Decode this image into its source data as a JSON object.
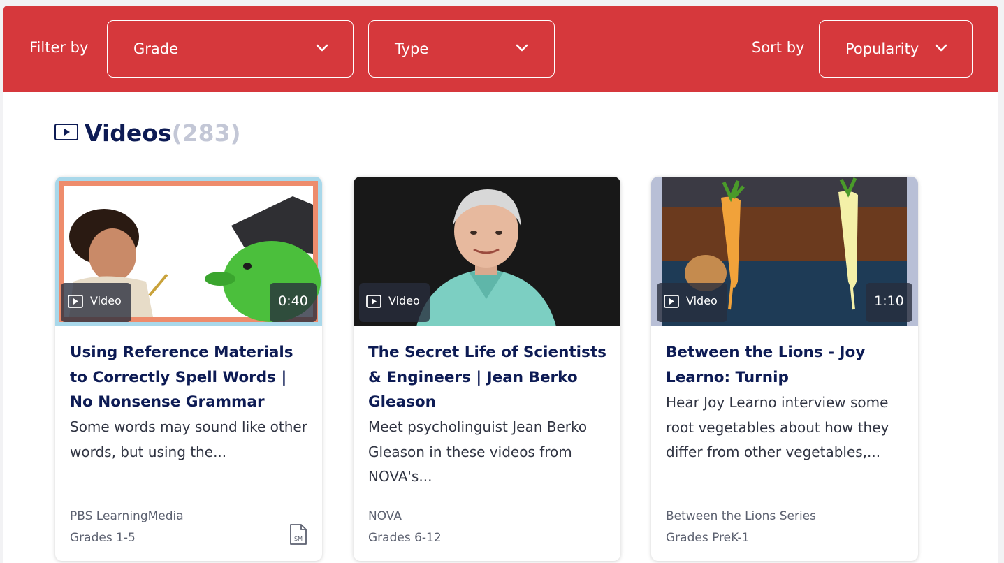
{
  "filter_bar": {
    "filter_label": "Filter by",
    "grade_dropdown": "Grade",
    "type_dropdown": "Type",
    "sort_label": "Sort by",
    "sort_dropdown": "Popularity",
    "bar_color": "#d6383c"
  },
  "section": {
    "title": "Videos",
    "count": "(283)",
    "icon": "video-play-icon"
  },
  "cards": [
    {
      "badge": "Video",
      "duration": "0:40",
      "title": "Using Reference Materials to Correctly Spell Words | No Nonsense Grammar",
      "description": "Some words may sound like other words, but using the...",
      "source": "PBS LearningMedia",
      "grades": "Grades 1-5",
      "extra_icon": "standards-map-icon",
      "extra_icon_text": "SM"
    },
    {
      "badge": "Video",
      "duration": "",
      "title": "The Secret Life of Scientists & Engineers | Jean Berko Gleason",
      "description": "Meet psycholinguist Jean Berko Gleason in these videos from NOVA's...",
      "source": "NOVA",
      "grades": "Grades 6-12"
    },
    {
      "badge": "Video",
      "duration": "1:10",
      "title": "Between the Lions - Joy Learno: Turnip",
      "description": "Hear Joy Learno interview some root vegetables about how they differ from other vegetables,...",
      "source": "Between the Lions Series",
      "grades": "Grades PreK-1"
    }
  ],
  "colors": {
    "title_navy": "#0d1b54",
    "count_gray": "#c3c7d6",
    "badge_bg": "#282d3c"
  }
}
